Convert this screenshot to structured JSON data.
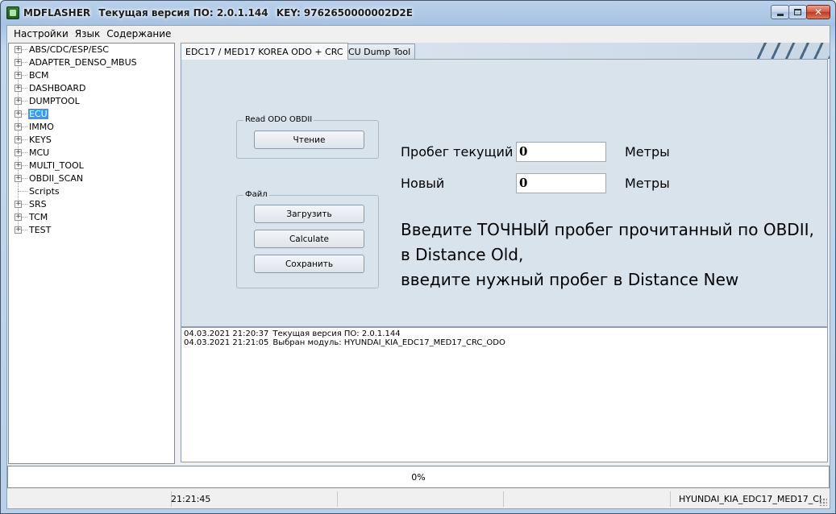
{
  "window": {
    "title_app": "MDFLASHER",
    "title_version": "Текущая версия ПО: 2.0.1.144",
    "title_key": "KEY: 9762650000002D2E",
    "minimize": "–",
    "maximize": "□",
    "close": "✕"
  },
  "menu": [
    "Настройки",
    "Язык",
    "Содержание"
  ],
  "tree": [
    {
      "label": "ABS/CDC/ESP/ESC",
      "expandable": true
    },
    {
      "label": "ADAPTER_DENSO_MBUS",
      "expandable": true
    },
    {
      "label": "BCM",
      "expandable": true
    },
    {
      "label": "DASHBOARD",
      "expandable": true
    },
    {
      "label": "DUMPTOOL",
      "expandable": true
    },
    {
      "label": "ECU",
      "expandable": true,
      "selected": true
    },
    {
      "label": "IMMO",
      "expandable": true
    },
    {
      "label": "KEYS",
      "expandable": true
    },
    {
      "label": "MCU",
      "expandable": true
    },
    {
      "label": "MULTI_TOOL",
      "expandable": true
    },
    {
      "label": "OBDII_SCAN",
      "expandable": true
    },
    {
      "label": "Scripts",
      "expandable": false
    },
    {
      "label": "SRS",
      "expandable": true
    },
    {
      "label": "TCM",
      "expandable": true
    },
    {
      "label": "TEST",
      "expandable": true
    }
  ],
  "tabs": [
    "EDC17 / MED17  KOREA  ODO  +  CRC",
    "ECU Dump Tool"
  ],
  "read_group": {
    "legend": "Read ODO OBDII",
    "read_button": "Чтение"
  },
  "file_group": {
    "legend": "Файл",
    "load_button": "Загрузить",
    "calc_button": "Calculate",
    "save_button": "Сохранить"
  },
  "odo": {
    "current_label": "Пробег текущий",
    "current_value": "0",
    "current_unit": "Метры",
    "new_label": "Новый",
    "new_value": "0",
    "new_unit": "Метры"
  },
  "instructions": [
    "Введите ТОЧНЫЙ пробег прочитанный по OBDII,",
    "в Distance Old,",
    "введите нужный пробег в Distance New"
  ],
  "log": [
    {
      "time": "04.03.2021 21:20:37",
      "text": "Текущая версия ПО: 2.0.1.144"
    },
    {
      "time": "04.03.2021 21:21:05",
      "text": "Выбран модуль:  HYUNDAI_KIA_EDC17_MED17_CRC_ODO"
    }
  ],
  "progress": {
    "text": "0%",
    "value": 0
  },
  "status": {
    "time": "21:21:45",
    "module": "HYUNDAI_KIA_EDC17_MED17_CI"
  }
}
